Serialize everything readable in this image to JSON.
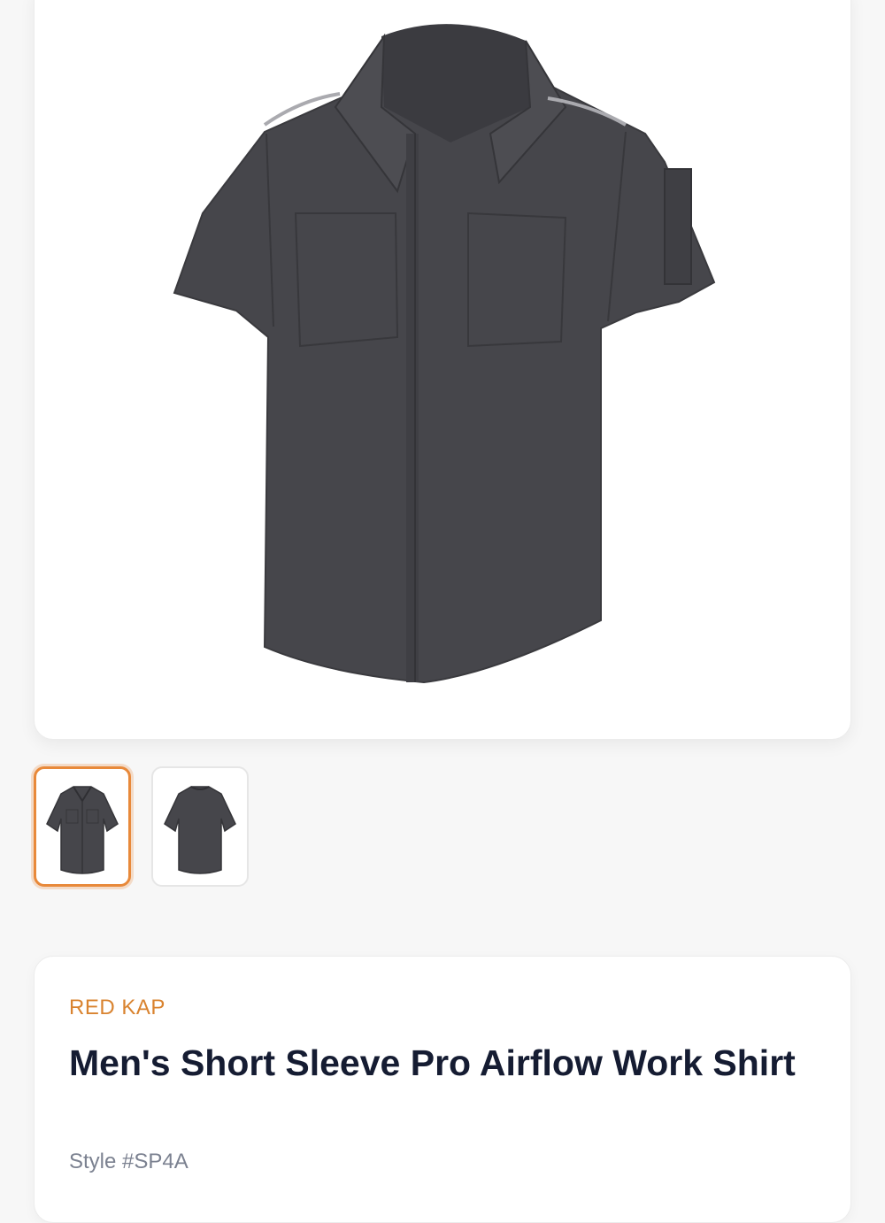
{
  "product": {
    "brand": "RED KAP",
    "title": "Men's Short Sleeve Pro Airflow Work Shirt",
    "style": "Style #SP4A"
  },
  "gallery": {
    "main_image": "shirt-front-image",
    "thumbnails": [
      {
        "view": "front",
        "selected": true
      },
      {
        "view": "back",
        "selected": false
      }
    ]
  },
  "colors": {
    "accent": "#e8893a",
    "brand_text": "#d9832f",
    "shirt": "#46464b",
    "title_text": "#151c32",
    "muted_text": "#7b8190"
  }
}
